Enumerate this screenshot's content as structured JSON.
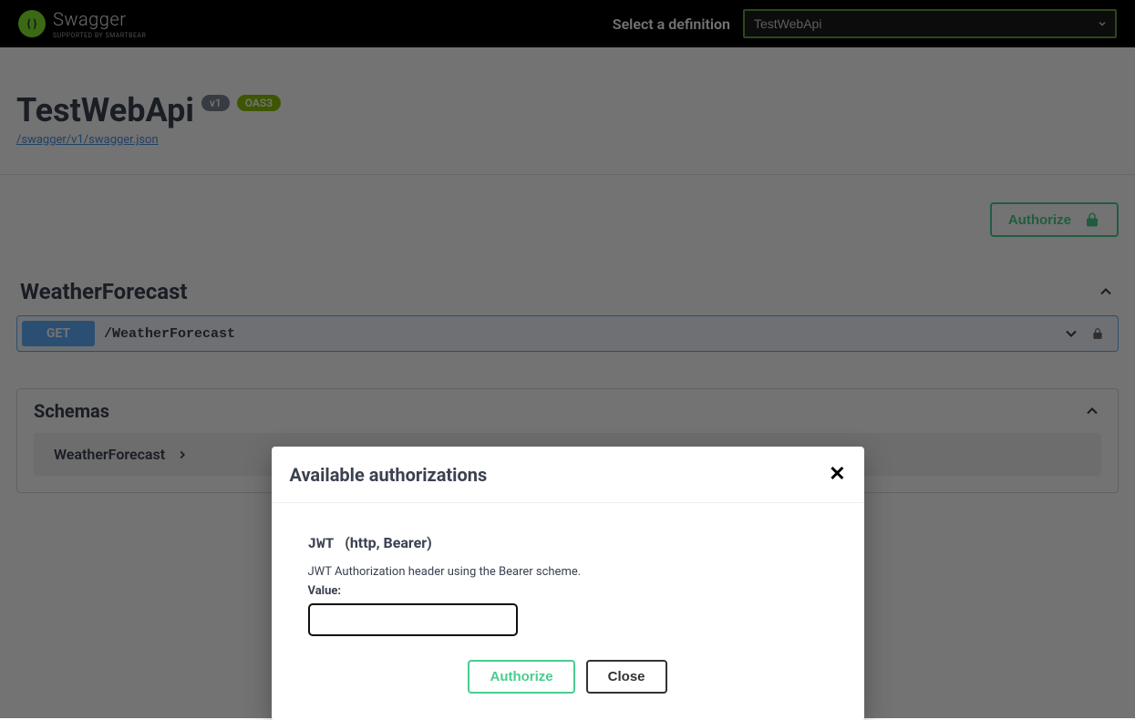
{
  "topbar": {
    "brand": "Swagger",
    "brand_sub": "supported by SMARTBEAR",
    "select_label": "Select a definition",
    "selected_definition": "TestWebApi"
  },
  "info": {
    "title": "TestWebApi",
    "version_badge": "v1",
    "oas_badge": "OAS3",
    "spec_url": "/swagger/v1/swagger.json"
  },
  "auth_button_label": "Authorize",
  "tags": {
    "0": {
      "name": "WeatherForecast",
      "ops": {
        "0": {
          "method": "GET",
          "path": "/WeatherForecast"
        }
      }
    }
  },
  "schemas": {
    "title": "Schemas",
    "items": {
      "0": {
        "name": "WeatherForecast"
      }
    }
  },
  "modal": {
    "title": "Available authorizations",
    "scheme_name": "JWT",
    "scheme_type": "(http, Bearer)",
    "description": "JWT Authorization header using the Bearer scheme.",
    "value_label": "Value:",
    "value": "",
    "authorize_label": "Authorize",
    "close_label": "Close"
  }
}
